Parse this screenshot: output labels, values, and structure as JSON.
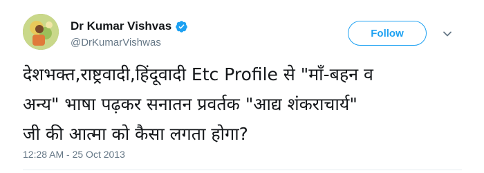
{
  "tweet": {
    "author": {
      "display_name": "Dr Kumar Vishvas",
      "handle": "@DrKumarVishwas",
      "verified": true,
      "avatar_icon": "profile-photo"
    },
    "follow_button_label": "Follow",
    "menu_icon": "chevron-down-icon",
    "text_lines": [
      "देशभक्त,राष्ट्रवादी,हिंदूवादी Etc Profile से \"माँ-बहन व",
      "अन्य\" भाषा पढ़कर सनातन प्रवर्तक \"आद्य शंकराचार्य\"",
      "जी की आत्मा को कैसा लगता होगा?"
    ],
    "timestamp": "12:28 AM - 25 Oct 2013"
  },
  "colors": {
    "accent": "#1da1f2",
    "text_primary": "#14171a",
    "text_secondary": "#657786",
    "divider": "#e6ecf0"
  }
}
